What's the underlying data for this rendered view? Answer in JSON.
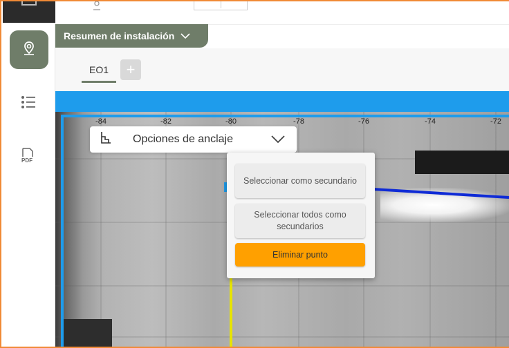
{
  "header": {
    "summary_label": "Resumen de instalación"
  },
  "tabs": [
    {
      "label": "EO1",
      "active": true
    }
  ],
  "add_tab_label": "+",
  "map": {
    "x_ticks": [
      "-84",
      "-82",
      "-80",
      "-78",
      "-76",
      "-74",
      "-72"
    ]
  },
  "anchor_options": {
    "label": "Opciones de anclaje"
  },
  "context_menu": {
    "select_secondary": "Seleccionar como secundario",
    "select_all_secondary": "Seleccionar todos como secundarios",
    "delete_point": "Eliminar punto"
  },
  "colors": {
    "accent": "#6f7d69",
    "blue": "#1e9cec",
    "delete": "#ffa000",
    "frame": "#f08a36",
    "yellow_line": "#e7e400",
    "blue_line": "#0f2bd6"
  },
  "icons": {
    "rail_location": "location-pin-icon",
    "rail_list": "list-icon",
    "rail_pdf": "pdf-icon",
    "anchor": "anchor-icon",
    "dropdown": "chevron-down-icon"
  }
}
